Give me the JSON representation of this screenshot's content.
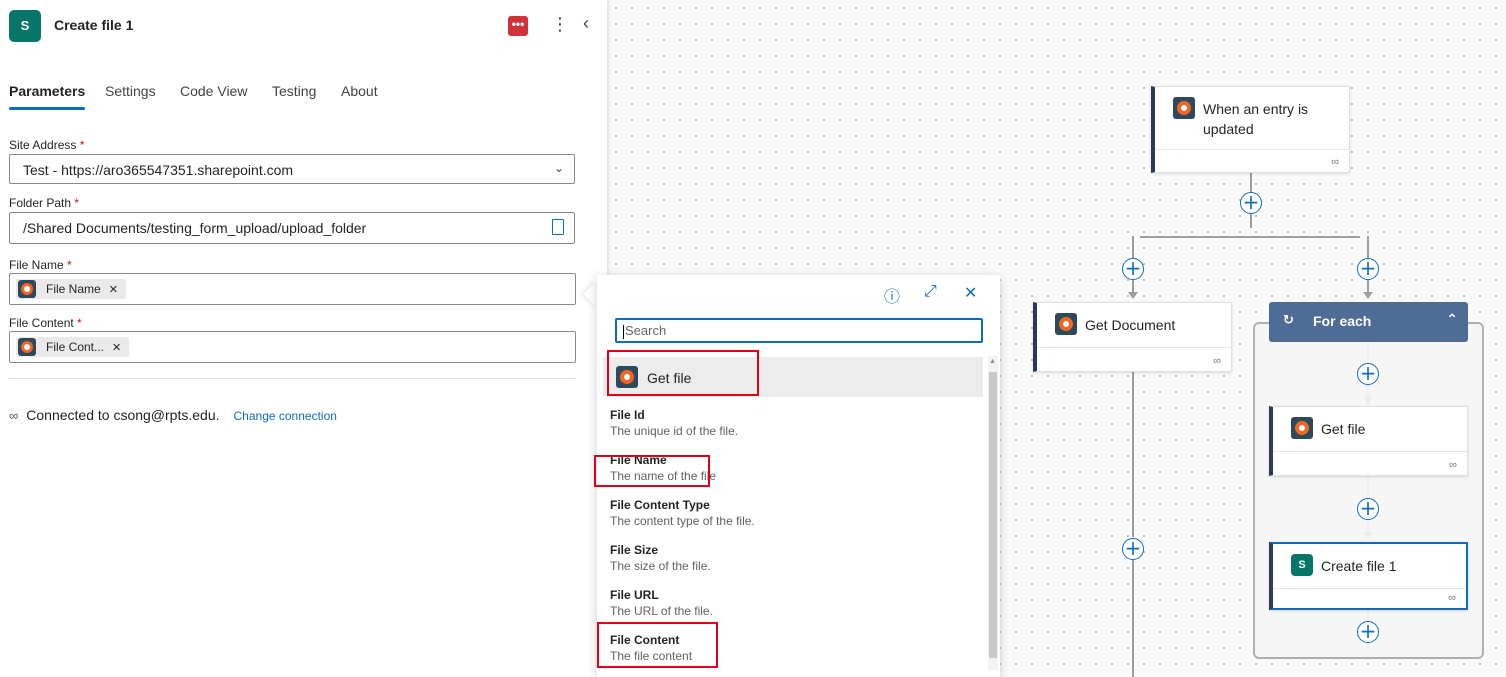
{
  "panel": {
    "title": "Create file 1",
    "app_badge": "S",
    "tabs": [
      "Parameters",
      "Settings",
      "Code View",
      "Testing",
      "About"
    ],
    "active_tab": "Parameters",
    "fields": {
      "site_address": {
        "label": "Site Address",
        "value": "Test - https://aro365547351.sharepoint.com"
      },
      "folder_path": {
        "label": "Folder Path",
        "value": "/Shared Documents/testing_form_upload/upload_folder"
      },
      "file_name": {
        "label": "File Name",
        "token": "File Name"
      },
      "file_content": {
        "label": "File Content",
        "token": "File Cont..."
      }
    },
    "required_mark": "*",
    "connection": {
      "text": "Connected to csong@rpts.edu.",
      "change_label": "Change connection"
    }
  },
  "popup": {
    "search_placeholder": "Search",
    "group_name": "Get file",
    "items": [
      {
        "name": "File Id",
        "desc": "The unique id of the file."
      },
      {
        "name": "File Name",
        "desc": "The name of the file"
      },
      {
        "name": "File Content Type",
        "desc": "The content type of the file."
      },
      {
        "name": "File Size",
        "desc": "The size of the file."
      },
      {
        "name": "File URL",
        "desc": "The URL of the file."
      },
      {
        "name": "File Content",
        "desc": "The file content"
      }
    ]
  },
  "flow": {
    "trigger": "When an entry is updated",
    "get_document": "Get Document",
    "for_each": "For each",
    "get_file": "Get file",
    "create_file": "Create file 1"
  },
  "colors": {
    "accent": "#0f6cbd",
    "sharepoint": "#077568",
    "foreach": "#4e6c96",
    "highlight": "#e0001b"
  }
}
